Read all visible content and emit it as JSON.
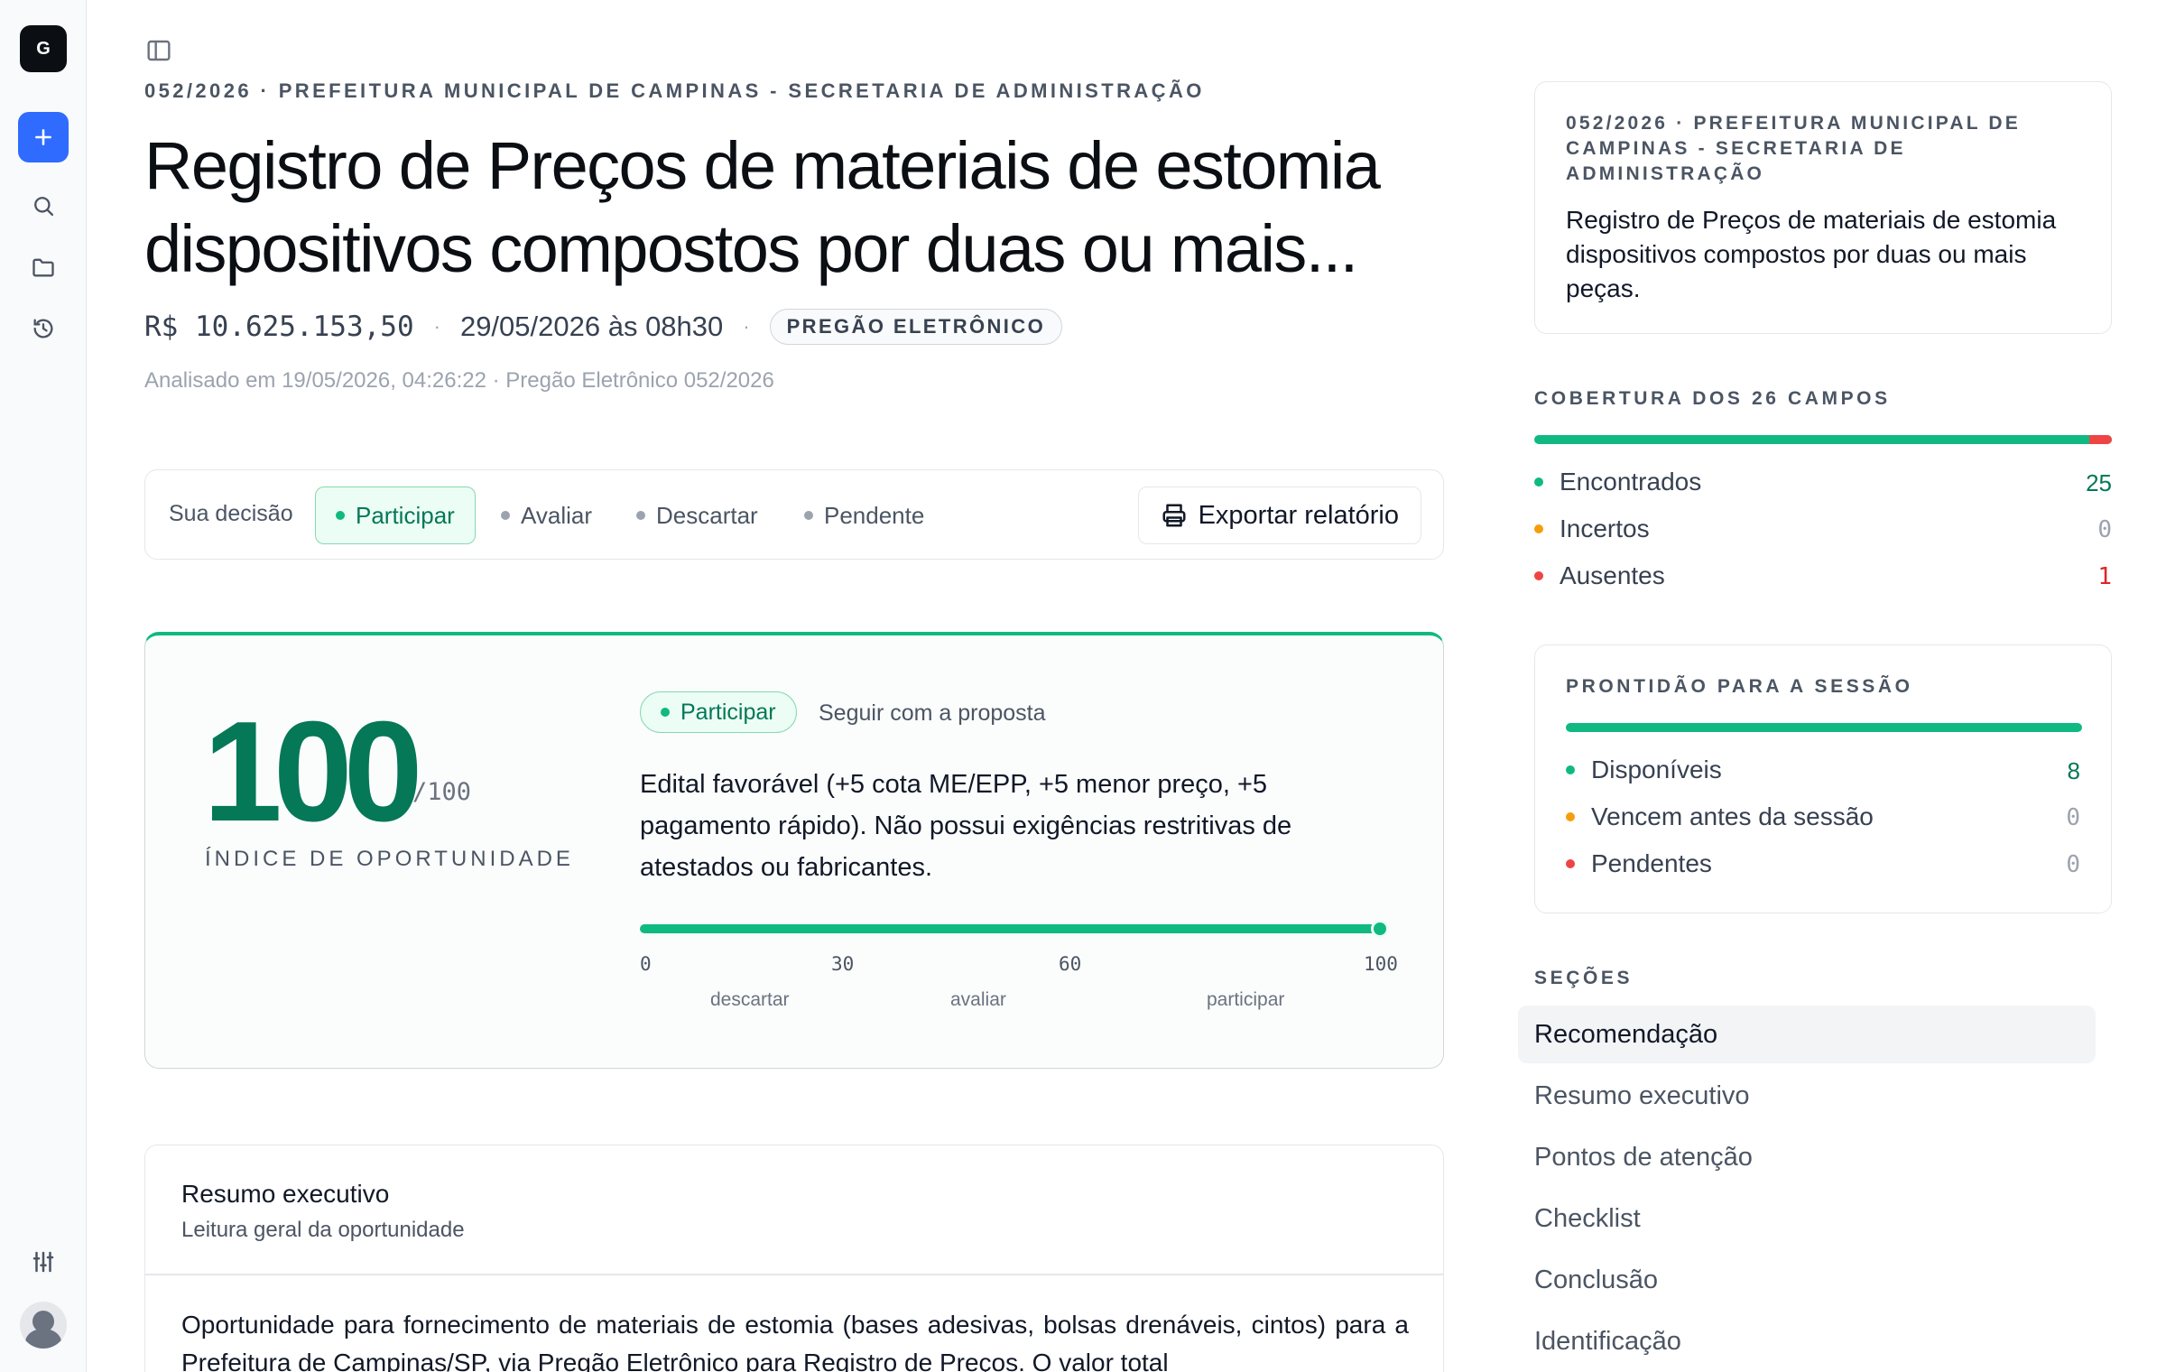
{
  "app": {
    "logo_letter": "G"
  },
  "rail": {
    "new_icon": "plus-icon",
    "icons": [
      "search-icon",
      "folder-icon",
      "history-icon"
    ],
    "bottom_icon": "sliders-icon",
    "avatar": "avatar"
  },
  "header": {
    "breadcrumb": "052/2026 · PREFEITURA MUNICIPAL DE CAMPINAS - SECRETARIA DE ADMINISTRAÇÃO",
    "title": "Registro de Preços de materiais de estomia dispositivos compostos por duas ou mais...",
    "value": "R$ 10.625.153,50",
    "date": "29/05/2026 às 08h30",
    "modality": "PREGÃO ELETRÔNICO",
    "analysed": "Analisado em 19/05/2026, 04:26:22 · Pregão Eletrônico 052/2026"
  },
  "decision": {
    "label": "Sua decisão",
    "options": [
      "Participar",
      "Avaliar",
      "Descartar",
      "Pendente"
    ],
    "selected": "Participar",
    "export_label": "Exportar relatório"
  },
  "score": {
    "value": "100",
    "max": "/100",
    "label": "ÍNDICE DE OPORTUNIDADE",
    "verdict": "Participar",
    "verdict_note": "Seguir com a proposta",
    "description": "Edital favorável (+5 cota ME/EPP, +5 menor preço, +5 pagamento rápido). Não possui exigências restritivas de atestados ou fabricantes.",
    "progress": 100,
    "ticks": [
      "0",
      "30",
      "60",
      "100"
    ],
    "zones": [
      "descartar",
      "avaliar",
      "participar"
    ]
  },
  "resumo": {
    "title": "Resumo executivo",
    "subtitle": "Leitura geral da oportunidade",
    "body": "Oportunidade para fornecimento de materiais de estomia (bases adesivas, bolsas drenáveis, cintos) para a Prefeitura de Campinas/SP, via Pregão Eletrônico para Registro de Preços. O valor total"
  },
  "sidebar": {
    "card_crumb": "052/2026 · PREFEITURA MUNICIPAL DE CAMPINAS - SECRETARIA DE ADMINISTRAÇÃO",
    "card_title": "Registro de Preços de materiais de estomia dispositivos compostos por duas ou mais peças.",
    "coverage": {
      "title": "COBERTURA DOS 26 CAMPOS",
      "found_fraction": 0.9615,
      "items": [
        {
          "label": "Encontrados",
          "value": "25",
          "color": "#10b981"
        },
        {
          "label": "Incertos",
          "value": "0",
          "color": "#f59e0b"
        },
        {
          "label": "Ausentes",
          "value": "1",
          "color": "#ef4444"
        }
      ]
    },
    "readiness": {
      "title": "PRONTIDÃO PARA A SESSÃO",
      "fraction": 1.0,
      "items": [
        {
          "label": "Disponíveis",
          "value": "8",
          "color": "#10b981"
        },
        {
          "label": "Vencem antes da sessão",
          "value": "0",
          "color": "#f59e0b"
        },
        {
          "label": "Pendentes",
          "value": "0",
          "color": "#ef4444"
        }
      ]
    },
    "sections_title": "SEÇÕES",
    "sections": [
      "Recomendação",
      "Resumo executivo",
      "Pontos de atenção",
      "Checklist",
      "Conclusão",
      "Identificação"
    ],
    "active_section": "Recomendação"
  },
  "colors": {
    "accent": "#10b981",
    "accent_dark": "#047857",
    "primary_button": "#2f6bff",
    "danger": "#ef4444",
    "warning": "#f59e0b"
  }
}
